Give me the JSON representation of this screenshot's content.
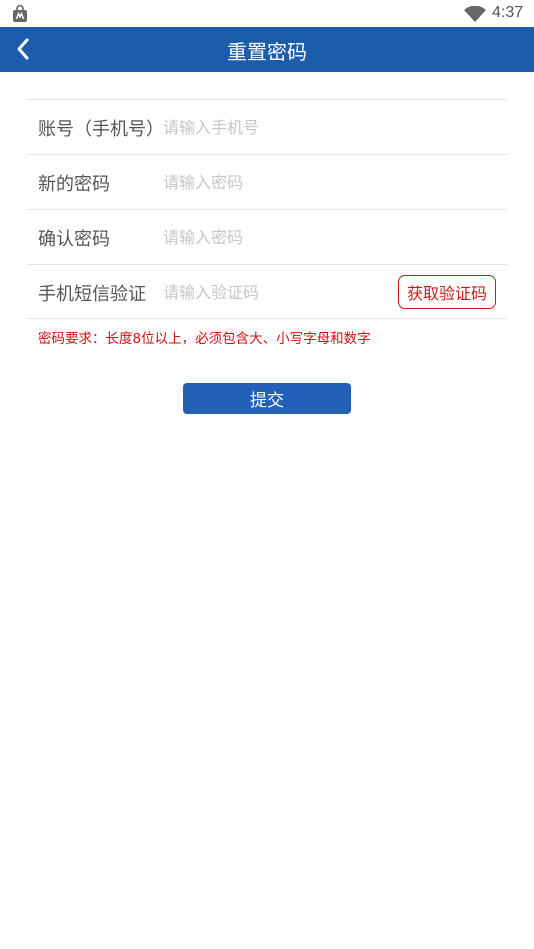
{
  "status_bar": {
    "time": "4:37",
    "app_icon": "store-bag-icon",
    "wifi_icon": "wifi-icon"
  },
  "header": {
    "title": "重置密码",
    "back_icon": "chevron-left-icon",
    "background_color": "#1b5cad"
  },
  "form": {
    "account": {
      "label": "账号（手机号）",
      "placeholder": "请输入手机号",
      "value": ""
    },
    "new_password": {
      "label": "新的密码",
      "placeholder": "请输入密码",
      "value": ""
    },
    "confirm_password": {
      "label": "确认密码",
      "placeholder": "请输入密码",
      "value": ""
    },
    "sms_code": {
      "label": "手机短信验证",
      "placeholder": "请输入验证码",
      "value": "",
      "button_label": "获取验证码"
    }
  },
  "hint": "密码要求：长度8位以上，必须包含大、小写字母和数字",
  "submit_label": "提交",
  "colors": {
    "accent": "#2360b7",
    "warning": "#cc1111"
  }
}
